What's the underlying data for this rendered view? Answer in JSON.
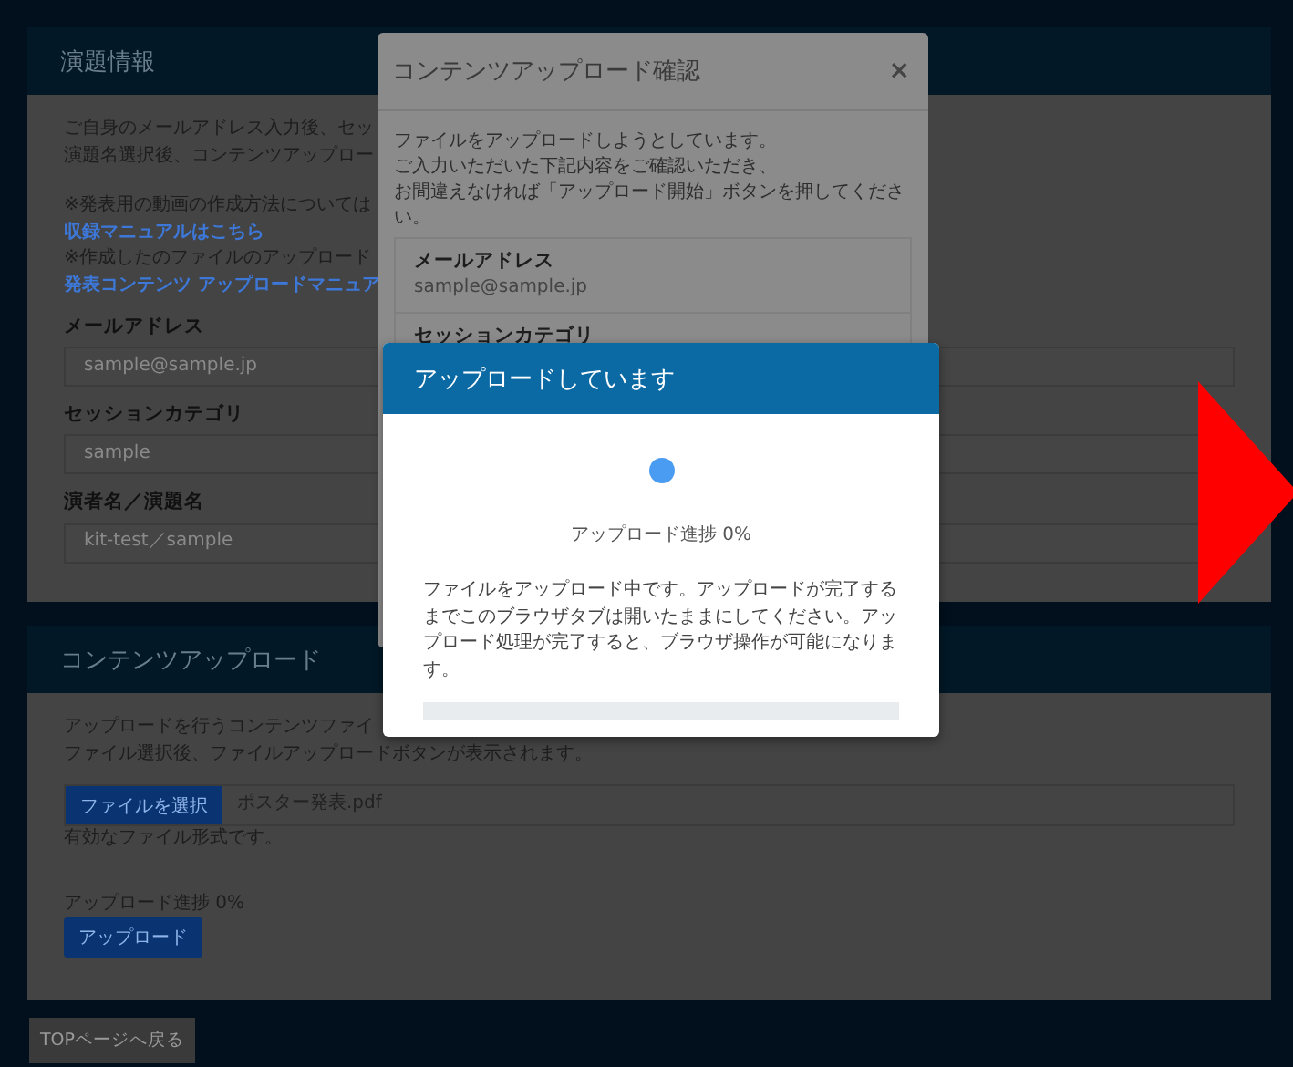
{
  "performance_card": {
    "title": "演題情報",
    "intro": [
      "ご自身のメールアドレス入力後、セッ",
      "演題名選択後、コンテンツアップロー"
    ],
    "notes": [
      {
        "kind": "note",
        "text": "※発表用の動画の作成方法については"
      },
      {
        "kind": "link",
        "text": "収録マニュアルはこちら"
      },
      {
        "kind": "note",
        "text": "※作成したのファイルのアップロード"
      },
      {
        "kind": "link",
        "text": "発表コンテンツ アップロードマニュア"
      }
    ],
    "fields": [
      {
        "label": "メールアドレス",
        "value": "sample@sample.jp"
      },
      {
        "label": "セッションカテゴリ",
        "value": "sample"
      },
      {
        "label": "演者名／演題名",
        "value": "kit-test／sample"
      }
    ]
  },
  "upload_card": {
    "title": "コンテンツアップロード",
    "intro": [
      "アップロードを行うコンテンツファイ",
      "ファイル選択後、ファイルアップロードボタンが表示されます。"
    ],
    "file_button": "ファイルを選択",
    "file_name": "ポスター発表.pdf",
    "file_status": "有効なファイル形式です。",
    "progress_text": "アップロード進捗 0%",
    "upload_button": "アップロード"
  },
  "back_button": "TOPページへ戻る",
  "confirm_dialog": {
    "title": "コンテンツアップロード確認",
    "close": "×",
    "message": [
      "ファイルをアップロードしようとしています。",
      "ご入力いただいた下記内容をご確認いただき、",
      "お間違えなければ「アップロード開始」ボタンを押してください。"
    ],
    "items": [
      {
        "label": "メールアドレス",
        "value": "sample@sample.jp"
      },
      {
        "label": "セッションカテゴリ"
      }
    ]
  },
  "upload_dialog": {
    "title": "アップロードしています",
    "progress_text": "アップロード進捗 0%",
    "message": "ファイルをアップロード中です。アップロードが完了するまでこのブラウザタブは開いたままにしてください。アップロード処理が完了すると、ブラウザ操作が可能になります。",
    "level": 0
  }
}
